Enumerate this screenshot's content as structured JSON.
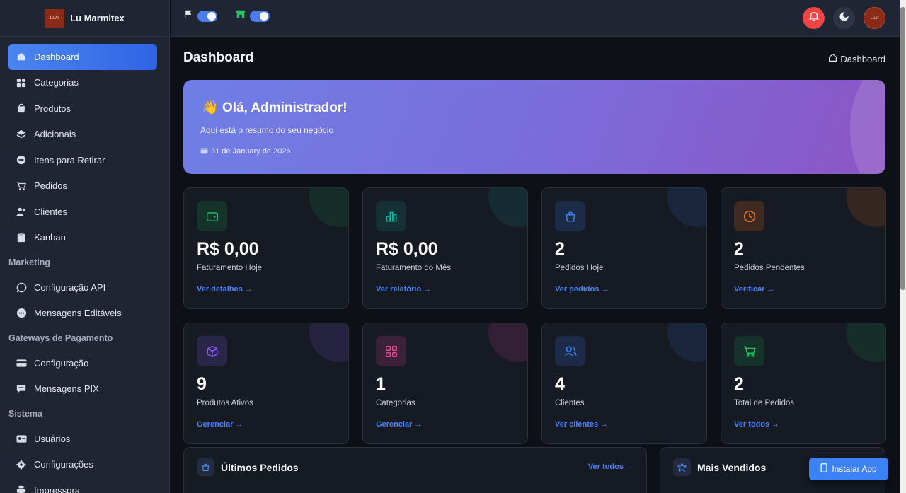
{
  "brand": {
    "name": "Lu Marmitex",
    "logo_text": "Lu Marmitex"
  },
  "sidebar": {
    "items": [
      {
        "label": "Dashboard",
        "icon": "home-icon"
      },
      {
        "label": "Categorias",
        "icon": "grid-icon"
      },
      {
        "label": "Produtos",
        "icon": "bag-icon"
      },
      {
        "label": "Adicionais",
        "icon": "layers-icon"
      },
      {
        "label": "Itens para Retirar",
        "icon": "minus-circle-icon"
      },
      {
        "label": "Pedidos",
        "icon": "cart-icon"
      },
      {
        "label": "Clientes",
        "icon": "users-icon"
      },
      {
        "label": "Kanban",
        "icon": "clipboard-icon"
      }
    ],
    "sections": [
      {
        "title": "Marketing",
        "items": [
          {
            "label": "Configuração API",
            "icon": "whatsapp-icon"
          },
          {
            "label": "Mensagens Editáveis",
            "icon": "chat-icon"
          }
        ]
      },
      {
        "title": "Gateways de Pagamento",
        "items": [
          {
            "label": "Configuração",
            "icon": "credit-card-icon"
          },
          {
            "label": "Mensagens PIX",
            "icon": "message-square-icon"
          }
        ]
      },
      {
        "title": "Sistema",
        "items": [
          {
            "label": "Usuários",
            "icon": "id-card-icon"
          },
          {
            "label": "Configurações",
            "icon": "gear-icon"
          },
          {
            "label": "Impressora",
            "icon": "printer-icon"
          }
        ]
      }
    ]
  },
  "topbar": {
    "toggles": [
      {
        "icon": "flag-icon",
        "on": true
      },
      {
        "icon": "store-icon",
        "on": true
      }
    ]
  },
  "page": {
    "title": "Dashboard",
    "breadcrumb": "Dashboard"
  },
  "hero": {
    "emoji": "👋",
    "title": "Olá, Administrador!",
    "subtitle": "Aqui está o resumo do seu negócio",
    "date": "31 de January de 2026"
  },
  "cards": [
    {
      "value": "R$ 0,00",
      "label": "Faturamento Hoje",
      "link": "Ver detalhes →",
      "icon": "wallet-icon",
      "color": "#22c55e"
    },
    {
      "value": "R$ 0,00",
      "label": "Faturamento do Mês",
      "link": "Ver relatório →",
      "icon": "bar-chart-icon",
      "color": "#14b8a6"
    },
    {
      "value": "2",
      "label": "Pedidos Hoje",
      "link": "Ver pedidos →",
      "icon": "shopping-bag-icon",
      "color": "#3b82f6"
    },
    {
      "value": "2",
      "label": "Pedidos Pendentes",
      "link": "Verificar →",
      "icon": "clock-icon",
      "color": "#f97316"
    },
    {
      "value": "9",
      "label": "Produtos Ativos",
      "link": "Gerenciar →",
      "icon": "box-icon",
      "color": "#8b5cf6"
    },
    {
      "value": "1",
      "label": "Categorias",
      "link": "Gerenciar →",
      "icon": "grid-icon",
      "color": "#ec4899"
    },
    {
      "value": "4",
      "label": "Clientes",
      "link": "Ver clientes →",
      "icon": "users-icon",
      "color": "#3b82f6"
    },
    {
      "value": "2",
      "label": "Total de Pedidos",
      "link": "Ver todos →",
      "icon": "cart-icon",
      "color": "#22c55e"
    }
  ],
  "panels": {
    "recent_orders": {
      "title": "Últimos Pedidos",
      "link": "Ver todos →",
      "icon": "shopping-bag-icon"
    },
    "best_sellers": {
      "title": "Mais Vendidos",
      "icon": "star-icon"
    }
  },
  "install_button": {
    "label": "Instalar App",
    "icon": "phone-icon"
  },
  "colors": {
    "accent": "#3b82f6",
    "hero_start": "#6e7fe6",
    "hero_end": "#8c55c4",
    "notify": "#ef4444"
  }
}
